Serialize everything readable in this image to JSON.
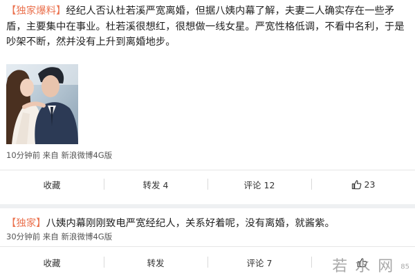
{
  "posts": [
    {
      "tag": "【独家爆料】",
      "body": "经纪人否认杜若溪严宽离婚，但据八姨内幕了解，夫妻二人确实存在一些矛盾，主要集中在事业。杜若溪很想红，很想做一线女星。严宽性格低调，不看中名利，于是吵架不断，然并没有上升到离婚地步。",
      "meta": "10分钟前 来自 新浪微博4G版",
      "actions": {
        "favorite": "收藏",
        "repost": "转发 4",
        "comment": "评论 12",
        "like_count": "23"
      }
    },
    {
      "tag": "【独家】",
      "body": "八姨内幕刚刚致电严宽经纪人，关系好着呢，没有离婚，就酱紫。",
      "meta": "30分钟前 来自 新浪微博4G版",
      "actions": {
        "favorite": "收藏",
        "repost": "转发",
        "comment": "评论 7"
      }
    }
  ],
  "watermark": {
    "text": "若 水 网",
    "small": "85"
  },
  "colors": {
    "tag": "#eb7350",
    "background": "#eef0f2",
    "card": "#ffffff"
  }
}
